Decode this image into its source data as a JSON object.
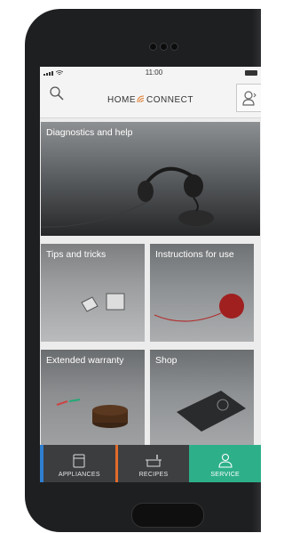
{
  "status_bar": {
    "time": "11:00"
  },
  "header": {
    "brand_left": "HOME",
    "brand_right": "CONNECT"
  },
  "tiles": {
    "diagnostics": "Diagnostics and help",
    "tips": "Tips and tricks",
    "instructions": "Instructions for use",
    "warranty": "Extended warranty",
    "shop": "Shop"
  },
  "tabbar": {
    "appliances": "APPLIANCES",
    "recipes": "RECIPES",
    "service": "SERVICE",
    "active": "SERVICE"
  },
  "colors": {
    "service_accent": "#2db08a",
    "appliances_accent": "#2e7fd0",
    "recipes_accent": "#e26c2a",
    "brand_signal": "#e07b2a"
  },
  "icons": [
    "search-icon",
    "user-icon",
    "wifi-signal-icon",
    "appliance-icon",
    "recipe-pot-icon",
    "service-person-icon",
    "battery-icon",
    "signal-icon"
  ]
}
